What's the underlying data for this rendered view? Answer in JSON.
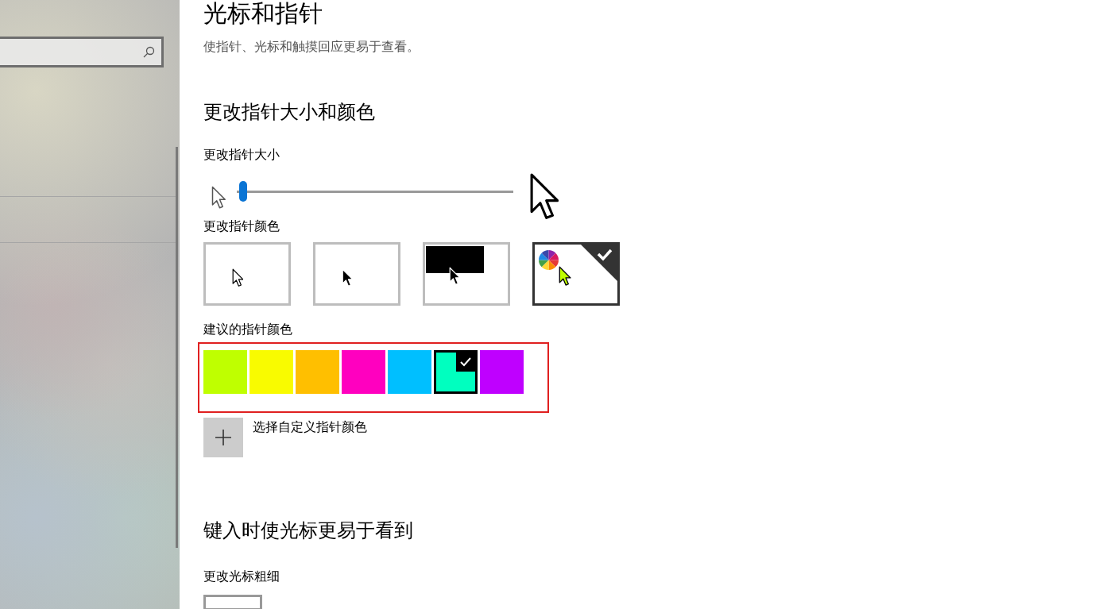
{
  "page": {
    "title": "光标和指针",
    "subtitle": "使指针、光标和触摸回应更易于查看。"
  },
  "pointer_section": {
    "heading": "更改指针大小和颜色",
    "size_label": "更改指针大小",
    "size_slider": {
      "level": 0.0
    },
    "color_label": "更改指针颜色",
    "pointer_styles": [
      {
        "kind": "white",
        "selected": false
      },
      {
        "kind": "black",
        "selected": false
      },
      {
        "kind": "inverted",
        "selected": false
      },
      {
        "kind": "custom",
        "selected": true
      }
    ],
    "suggested_label": "建议的指针颜色",
    "suggested_colors": [
      {
        "color": "#bfff00",
        "selected": false
      },
      {
        "color": "#f9fb00",
        "selected": false
      },
      {
        "color": "#ffbf00",
        "selected": false
      },
      {
        "color": "#ff00bf",
        "selected": false
      },
      {
        "color": "#00bfff",
        "selected": false
      },
      {
        "color": "#00ffbf",
        "selected": true
      },
      {
        "color": "#bf00ff",
        "selected": false
      }
    ],
    "custom_color_label": "选择自定义指针颜色"
  },
  "cursor_section": {
    "heading": "键入时使光标更易于看到",
    "thickness_label": "更改光标粗细"
  }
}
